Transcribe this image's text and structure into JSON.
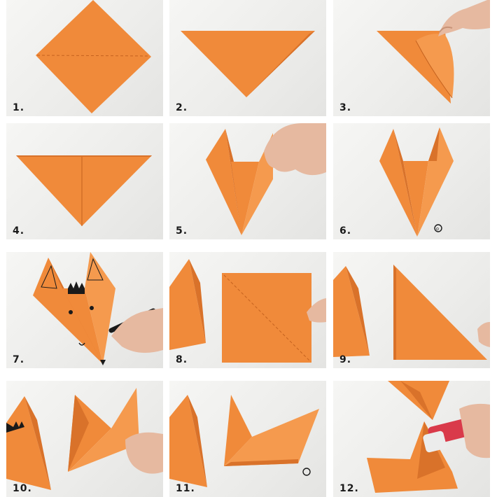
{
  "colors": {
    "paper": "#f08a3a",
    "paper_dark": "#d9722a",
    "paper_light": "#f59a4e",
    "background": "#efefed",
    "skin": "#e6b9a0",
    "ink": "#1a1a1a",
    "glue_red": "#d93a4a"
  },
  "panels": [
    {
      "step_label": "1."
    },
    {
      "step_label": "2."
    },
    {
      "step_label": "3."
    },
    {
      "step_label": "4."
    },
    {
      "step_label": "5."
    },
    {
      "step_label": "6."
    },
    {
      "step_label": "7."
    },
    {
      "step_label": "8."
    },
    {
      "step_label": "9."
    },
    {
      "step_label": "10."
    },
    {
      "step_label": "11."
    },
    {
      "step_label": "12."
    }
  ]
}
